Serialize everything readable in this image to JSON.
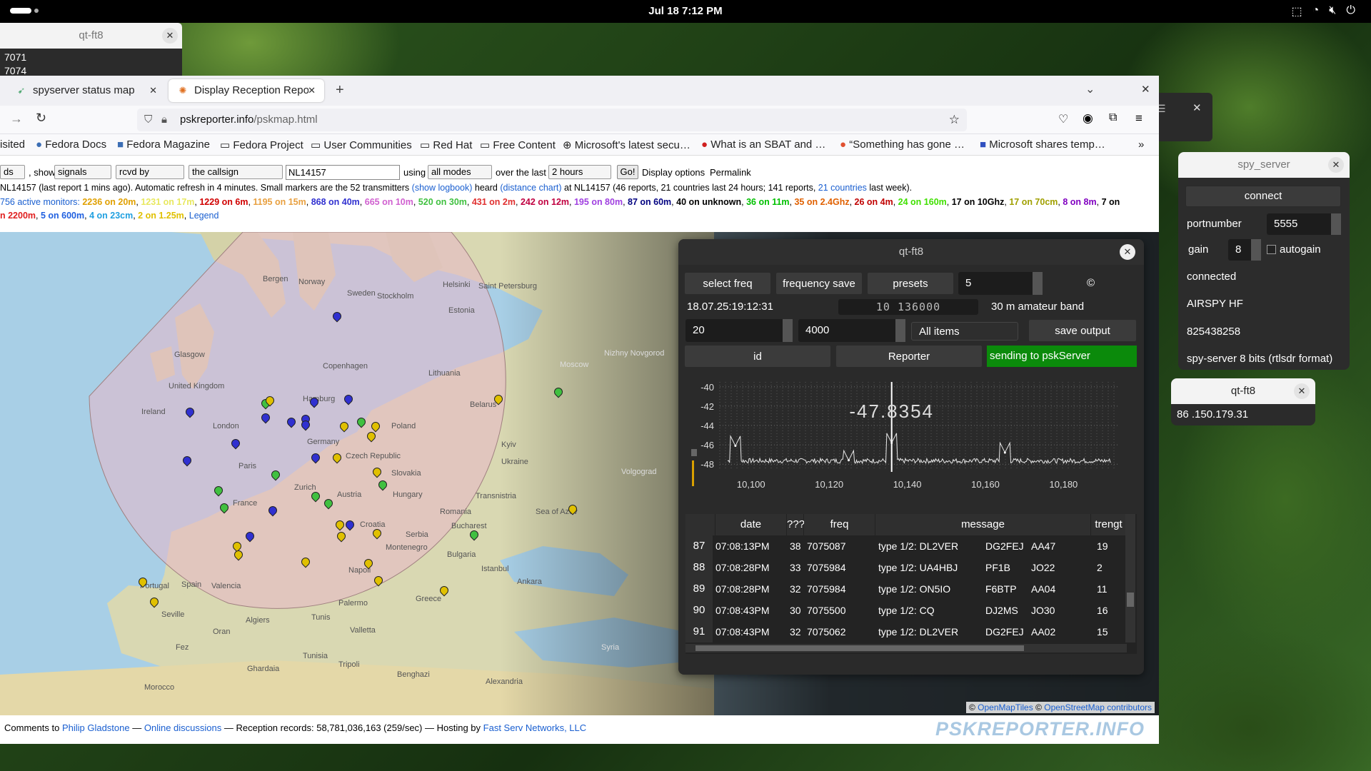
{
  "topbar": {
    "clock": "Jul 18   7:12 PM"
  },
  "small_qt": {
    "title": "qt-ft8",
    "lines": [
      "7071",
      "7074"
    ]
  },
  "browser": {
    "tabs": [
      {
        "label": "spyserver status map"
      },
      {
        "label": "Display Reception Report"
      }
    ],
    "url_host": "pskreporter.info",
    "url_path": "/pskmap.html",
    "bookmarks": [
      "isited",
      "Fedora Docs",
      "Fedora Magazine",
      "Fedora Project",
      "User Communities",
      "Red Hat",
      "Free Content",
      "Microsoft's latest secu…",
      "What is an SBAT and …",
      "“Something has gone …",
      "Microsoft shares temp…"
    ]
  },
  "controls": {
    "first_select": "ds",
    "show_label": ", show",
    "show_value": "signals",
    "rcvd": "rcvd by",
    "callsign_select": "the callsign",
    "callsign": "NL14157",
    "using": "using",
    "modes": "all modes",
    "over_the_last": "over the last",
    "period": "2 hours",
    "go": "Go!",
    "display_options": "Display options",
    "permalink": "Permalink"
  },
  "status": {
    "line1_a": "NL14157 (last report 1 mins ago). Automatic refresh in 4 minutes. Small markers are the 52 transmitters",
    "show_logbook": "(show logbook)",
    "heard": "heard",
    "distance_chart": "(distance chart)",
    "line1_b": "at NL14157 (46 reports, 21 countries last 24 hours; 141 reports,",
    "countries": "21 countries",
    "line1_c": "last week).",
    "monitors": "756 active monitors:",
    "bands": [
      {
        "t": "2236 on 20m",
        "c": "#e0a000"
      },
      {
        "t": "1231 on 17m",
        "c": "#e8e860"
      },
      {
        "t": "1229 on 6m",
        "c": "#d00000"
      },
      {
        "t": "1195 on 15m",
        "c": "#e8a040"
      },
      {
        "t": "868 on 40m",
        "c": "#3030d0"
      },
      {
        "t": "665 on 10m",
        "c": "#d060d0"
      },
      {
        "t": "520 on 30m",
        "c": "#40c040"
      },
      {
        "t": "431 on 2m",
        "c": "#e03030"
      },
      {
        "t": "242 on 12m",
        "c": "#c00040"
      },
      {
        "t": "195 on 80m",
        "c": "#a040e0"
      },
      {
        "t": "87 on 60m",
        "c": "#000080"
      },
      {
        "t": "40 on unknown",
        "c": "#000000"
      },
      {
        "t": "36 on 11m",
        "c": "#00c000"
      },
      {
        "t": "35 on 2.4Ghz",
        "c": "#e06000"
      },
      {
        "t": "26 on 4m",
        "c": "#c00000"
      },
      {
        "t": "24 on 160m",
        "c": "#40e000"
      },
      {
        "t": "17 on 10Ghz",
        "c": "#000000"
      },
      {
        "t": "17 on 70cm",
        "c": "#a0a000"
      },
      {
        "t": "8 on 8m",
        "c": "#8000c0"
      },
      {
        "t": "7 on",
        "c": "#000000"
      }
    ],
    "bands2": [
      {
        "t": "n 2200m",
        "c": "#e02020"
      },
      {
        "t": "5 on 600m",
        "c": "#2060e0"
      },
      {
        "t": "4 on 23cm",
        "c": "#20a0e0"
      },
      {
        "t": "2 on 1.25m",
        "c": "#e0c000"
      }
    ],
    "legend": "Legend"
  },
  "map": {
    "labels": [
      "Norway",
      "Sweden",
      "Helsinki",
      "Saint Petersburg",
      "Estonia",
      "Stockholm",
      "Bergen",
      "Glasgow",
      "United Kingdom",
      "Ireland",
      "London",
      "Copenhagen",
      "Lithuania",
      "Hamburg",
      "Belarus",
      "Moscow",
      "Nizhny Novgorod",
      "Poland",
      "Germany",
      "Czech Republic",
      "Paris",
      "France",
      "Slovakia",
      "Kyiv",
      "Ukraine",
      "Hungary",
      "Volgograd",
      "Zurich",
      "Austria",
      "Transnistria",
      "Sea of Azov",
      "Romania",
      "Croatia",
      "Serbia",
      "Bucharest",
      "Montenegro",
      "Bulgaria",
      "Istanbul",
      "Portugal",
      "Spain",
      "Valencia",
      "Napoli",
      "Ankara",
      "Seville",
      "Palermo",
      "Greece",
      "Algiers",
      "Tunis",
      "Oran",
      "Valletta",
      "Fez",
      "Tunisia",
      "Tripoli",
      "Ghardaia",
      "Morocco",
      "Benghazi",
      "Syria",
      "Alexandria"
    ],
    "attribution_a": "OpenMapTiles",
    "attribution_b": "OpenStreetMap contributors"
  },
  "footer": {
    "comments": "Comments to",
    "author": "Philip Gladstone",
    "sep1": "—",
    "online": "Online discussions",
    "rest": "— Reception records: 58,781,036,163 (259/sec) — Hosting by",
    "hosting": "Fast Serv Networks, LLC",
    "brand": "PSKREPORTER.INFO"
  },
  "qt": {
    "title": "qt-ft8",
    "select_freq": "select freq",
    "frequency_save": "frequency save",
    "presets": "presets",
    "preset_value": "5",
    "copyright": "©",
    "timestamp": "18.07.25:19:12:31",
    "freq_display": "10 136000",
    "band": "30 m amateur band",
    "val20": "20",
    "val4000": "4000",
    "filter": "All items",
    "save_output": "save output",
    "id_btn": "id",
    "reporter_btn": "Reporter",
    "status": "sending to pskServer",
    "readout": "-47.8354",
    "columns": [
      "date",
      "???",
      "freq",
      "message",
      "trengt"
    ],
    "rows": [
      {
        "n": "87",
        "date": "07:08:13PM",
        "q": "38",
        "freq": "7075087",
        "msg": "type 1/2: DL2VER",
        "call": "DG2FEJ",
        "grid": "AA47",
        "s": "19"
      },
      {
        "n": "88",
        "date": "07:08:28PM",
        "q": "33",
        "freq": "7075984",
        "msg": "type 1/2: UA4HBJ",
        "call": "PF1B",
        "grid": "JO22",
        "s": "2"
      },
      {
        "n": "89",
        "date": "07:08:28PM",
        "q": "32",
        "freq": "7075984",
        "msg": "type 1/2: ON5IO",
        "call": "F6BTP",
        "grid": "AA04",
        "s": "11"
      },
      {
        "n": "90",
        "date": "07:08:43PM",
        "q": "30",
        "freq": "7075500",
        "msg": "type 1/2: CQ",
        "call": "DJ2MS",
        "grid": "JO30",
        "s": "16"
      },
      {
        "n": "91",
        "date": "07:08:43PM",
        "q": "32",
        "freq": "7075062",
        "msg": "type 1/2: DL2VER",
        "call": "DG2FEJ",
        "grid": "AA02",
        "s": "15"
      }
    ]
  },
  "chart_data": {
    "type": "line",
    "x_ticks": [
      "10,100",
      "10,120",
      "10,140",
      "10,160",
      "10,180"
    ],
    "y_ticks": [
      "-40",
      "-42",
      "-44",
      "-46",
      "-48"
    ],
    "ylim": [
      -48.5,
      -39.5
    ],
    "xlim": [
      10092,
      10194
    ],
    "marker_x": 10136,
    "peaks": [
      {
        "x": 10096,
        "y": -46.1
      },
      {
        "x": 10136,
        "y": -45.8
      },
      {
        "x": 10165,
        "y": -46.8
      },
      {
        "x": 10125,
        "y": -47.6
      }
    ],
    "baseline": -47.9,
    "readout": "-47.8354"
  },
  "spy": {
    "title": "spy_server",
    "connect": "connect",
    "portnumber": "portnumber",
    "port": "5555",
    "gain": "gain",
    "gain_val": "8",
    "autogain": "autogain",
    "connected": "connected",
    "device": "AIRSPY HF",
    "serial": "825438258",
    "format": "spy-server 8 bits  (rtlsdr format)"
  },
  "qt2": {
    "title": "qt-ft8",
    "ip": "86 .150.179.31"
  }
}
